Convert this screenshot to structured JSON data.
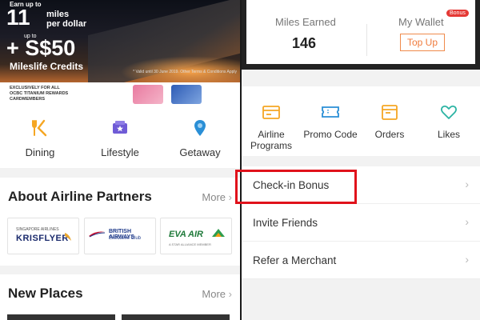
{
  "banner": {
    "earn_up_to": "Earn up to",
    "miles_number": "11",
    "miles_text": "miles\nper dollar",
    "up_to": "up to",
    "bonus_amount": "+ S$50",
    "credits_text": "Mileslife Credits",
    "valid_note": "* Valid until 30 June 2019. Other Terms & Conditions Apply"
  },
  "card_strip": {
    "text": "EXCLUSIVELY FOR ALL\nOCBC TITANIUM REWARDS CARDMEMBERS"
  },
  "categories": [
    {
      "label": "Dining",
      "icon": "dining-icon"
    },
    {
      "label": "Lifestyle",
      "icon": "lifestyle-icon"
    },
    {
      "label": "Getaway",
      "icon": "getaway-icon"
    }
  ],
  "about": {
    "title": "About Airline Partners",
    "more": "More",
    "partners": [
      {
        "top": "SINGAPORE AIRLINES",
        "name": "KRISFLYER"
      },
      {
        "name": "BRITISH AIRWAYS",
        "sub": "Executive Club"
      },
      {
        "name": "EVA AIR",
        "sub": "A STAR ALLIANCE MEMBER"
      }
    ]
  },
  "new_places": {
    "title": "New Places",
    "more": "More"
  },
  "wallet": {
    "miles_earned_label": "Miles Earned",
    "miles_earned_value": "146",
    "my_wallet_label": "My Wallet",
    "bonus_badge": "Bonus",
    "top_up": "Top Up"
  },
  "shortcuts": [
    {
      "label": "Airline\nPrograms",
      "icon": "airline-programs-icon"
    },
    {
      "label": "Promo Code",
      "icon": "promo-code-icon"
    },
    {
      "label": "Orders",
      "icon": "orders-icon"
    },
    {
      "label": "Likes",
      "icon": "likes-icon"
    }
  ],
  "menu": [
    {
      "label": "Check-in Bonus"
    },
    {
      "label": "Invite Friends"
    },
    {
      "label": "Refer a Merchant"
    }
  ],
  "colors": {
    "accent_orange": "#f5a623",
    "icon_blue": "#2a8fd6",
    "icon_purple": "#6f5bd6",
    "icon_teal": "#2bb3a3",
    "topup_orange": "#f07a3b",
    "badge_red": "#e53935",
    "highlight_red": "#e0121b"
  }
}
